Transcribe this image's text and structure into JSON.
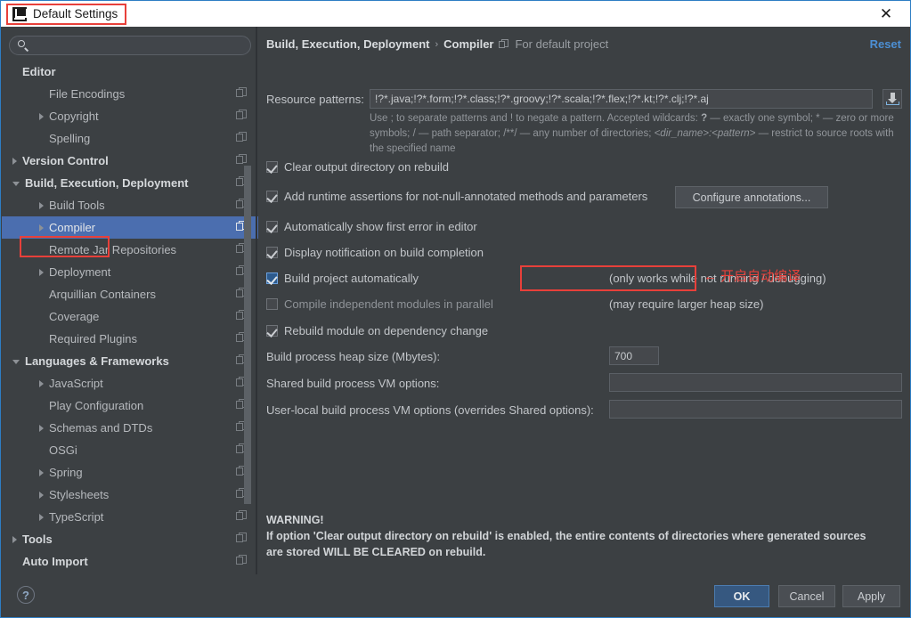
{
  "window": {
    "title": "Default Settings",
    "title_icon": "intellij-logo-icon",
    "close_label": "✕"
  },
  "sidebar": {
    "search": {
      "value": "",
      "placeholder": ""
    },
    "items": [
      {
        "label": "Editor",
        "indent": 0,
        "arrow": "none",
        "bold": true,
        "badge": false,
        "selected": false
      },
      {
        "label": "File Encodings",
        "indent": 1,
        "arrow": "none",
        "bold": false,
        "badge": true,
        "selected": false
      },
      {
        "label": "Copyright",
        "indent": 1,
        "arrow": "closed",
        "bold": false,
        "badge": true,
        "selected": false
      },
      {
        "label": "Spelling",
        "indent": 1,
        "arrow": "none",
        "bold": false,
        "badge": true,
        "selected": false
      },
      {
        "label": "Version Control",
        "indent": 0,
        "arrow": "closed",
        "bold": true,
        "badge": true,
        "selected": false
      },
      {
        "label": "Build, Execution, Deployment",
        "indent": 0,
        "arrow": "open",
        "bold": true,
        "badge": true,
        "selected": false
      },
      {
        "label": "Build Tools",
        "indent": 1,
        "arrow": "closed",
        "bold": false,
        "badge": true,
        "selected": false
      },
      {
        "label": "Compiler",
        "indent": 1,
        "arrow": "closed",
        "bold": false,
        "badge": true,
        "selected": true
      },
      {
        "label": "Remote Jar Repositories",
        "indent": 1,
        "arrow": "none",
        "bold": false,
        "badge": true,
        "selected": false
      },
      {
        "label": "Deployment",
        "indent": 1,
        "arrow": "closed",
        "bold": false,
        "badge": true,
        "selected": false
      },
      {
        "label": "Arquillian Containers",
        "indent": 1,
        "arrow": "none",
        "bold": false,
        "badge": true,
        "selected": false
      },
      {
        "label": "Coverage",
        "indent": 1,
        "arrow": "none",
        "bold": false,
        "badge": true,
        "selected": false
      },
      {
        "label": "Required Plugins",
        "indent": 1,
        "arrow": "none",
        "bold": false,
        "badge": true,
        "selected": false
      },
      {
        "label": "Languages & Frameworks",
        "indent": 0,
        "arrow": "open",
        "bold": true,
        "badge": true,
        "selected": false
      },
      {
        "label": "JavaScript",
        "indent": 1,
        "arrow": "closed",
        "bold": false,
        "badge": true,
        "selected": false
      },
      {
        "label": "Play Configuration",
        "indent": 1,
        "arrow": "none",
        "bold": false,
        "badge": true,
        "selected": false
      },
      {
        "label": "Schemas and DTDs",
        "indent": 1,
        "arrow": "closed",
        "bold": false,
        "badge": true,
        "selected": false
      },
      {
        "label": "OSGi",
        "indent": 1,
        "arrow": "none",
        "bold": false,
        "badge": true,
        "selected": false
      },
      {
        "label": "Spring",
        "indent": 1,
        "arrow": "closed",
        "bold": false,
        "badge": true,
        "selected": false
      },
      {
        "label": "Stylesheets",
        "indent": 1,
        "arrow": "closed",
        "bold": false,
        "badge": true,
        "selected": false
      },
      {
        "label": "TypeScript",
        "indent": 1,
        "arrow": "closed",
        "bold": false,
        "badge": true,
        "selected": false
      },
      {
        "label": "Tools",
        "indent": 0,
        "arrow": "closed",
        "bold": true,
        "badge": true,
        "selected": false
      },
      {
        "label": "Auto Import",
        "indent": 0,
        "arrow": "none",
        "bold": true,
        "badge": true,
        "selected": false
      }
    ]
  },
  "main": {
    "breadcrumb": {
      "root": "Build, Execution, Deployment",
      "separator": "›",
      "leaf": "Compiler",
      "scope_icon": "project-scope-icon",
      "scope_text": "For default project"
    },
    "reset_label": "Reset",
    "resource_patterns": {
      "label": "Resource patterns:",
      "value": "!?*.java;!?*.form;!?*.class;!?*.groovy;!?*.scala;!?*.flex;!?*.kt;!?*.clj;!?*.aj",
      "browse_icon": "import-icon",
      "hint_part1": "Use ; to separate patterns and ! to negate a pattern. Accepted wildcards: ",
      "hint_q": "?",
      "hint_part2": " — exactly one symbol; * — zero or more symbols; / — path separator; /**/ — any number of directories;  ",
      "hint_dir": "<dir_name>:<pattern>",
      "hint_part3": " — restrict to source roots with the specified name"
    },
    "checkboxes": [
      {
        "label": "Clear output directory on rebuild",
        "checked": true,
        "focused": false,
        "enabled": true
      },
      {
        "label": "Add runtime assertions for not-null-annotated methods and parameters",
        "checked": true,
        "focused": false,
        "enabled": true
      },
      {
        "label": "Automatically show first error in editor",
        "checked": true,
        "focused": false,
        "enabled": true
      },
      {
        "label": "Display notification on build completion",
        "checked": true,
        "focused": false,
        "enabled": true
      },
      {
        "label": "Build project automatically",
        "checked": true,
        "focused": true,
        "enabled": true
      },
      {
        "label": "Compile independent modules in parallel",
        "checked": false,
        "focused": false,
        "enabled": false
      },
      {
        "label": "Rebuild module on dependency change",
        "checked": true,
        "focused": false,
        "enabled": true
      }
    ],
    "configure_annotations_label": "Configure annotations...",
    "note_auto_build": "(only works while not running / debugging)",
    "note_parallel": "(may require larger heap size)",
    "annotation_cn": "← 开启自动编译",
    "fields": [
      {
        "label": "Build process heap size (Mbytes):",
        "value": "700",
        "placeholder": ""
      },
      {
        "label": "Shared build process VM options:",
        "value": "",
        "placeholder": ""
      },
      {
        "label": "User-local build process VM options (overrides Shared options):",
        "value": "",
        "placeholder": ""
      }
    ],
    "warning": {
      "title": "WARNING!",
      "line1": "If option 'Clear output directory on rebuild' is enabled, the entire contents of directories where generated sources",
      "line2": "are stored WILL BE CLEARED on rebuild."
    }
  },
  "footer": {
    "help_label": "?",
    "ok_label": "OK",
    "cancel_label": "Cancel",
    "apply_label": "Apply"
  },
  "colors": {
    "accent_blue": "#4b6eaf",
    "link_blue": "#4c8fd4",
    "annotation_red": "#e8403a",
    "panel_bg": "#3c4043"
  }
}
